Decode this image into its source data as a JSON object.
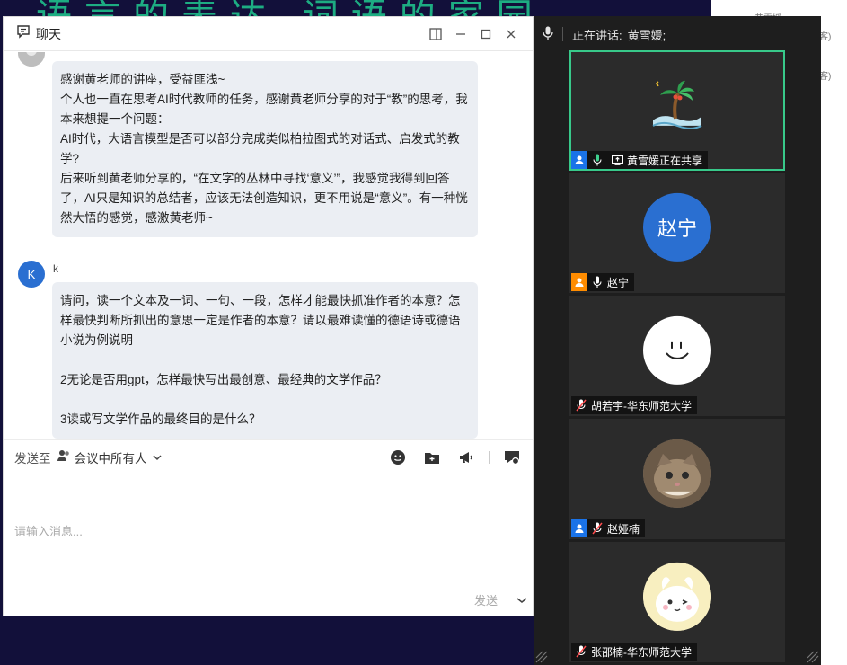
{
  "background": {
    "banner": "语言的表达  词语的家园",
    "right_lines": [
      "黄雪媛",
      "访客)",
      "访客)"
    ]
  },
  "chat": {
    "title": "聊天",
    "messages": [
      {
        "sender": "",
        "avatar_letter": "",
        "lines": [
          "感谢黄老师的讲座，受益匪浅~",
          "个人也一直在思考AI时代教师的任务，感谢黄老师分享的对于“教”的思考，我本来想提一个问题：",
          "AI时代，大语言模型是否可以部分完成类似柏拉图式的对话式、启发式的教学?",
          "后来听到黄老师分享的，“在文字的丛林中寻找‘意义’”，我感觉我得到回答了，AI只是知识的总结者，应该无法创造知识，更不用说是“意义”。有一种恍然大悟的感觉，感激黄老师~"
        ]
      },
      {
        "sender": "k",
        "avatar_letter": "K",
        "lines": [
          "请问，读一个文本及一词、一句、一段，怎样才能最快抓准作者的本意？怎样最快判断所抓出的意思一定是作者的本意？请以最难读懂的德语诗或德语小说为例说明",
          "",
          "2无论是否用gpt，怎样最快写出最创意、最经典的文学作品？",
          "",
          "3读或写文学作品的最终目的是什么？"
        ]
      }
    ],
    "send_to_label": "发送至",
    "recipient": "会议中所有人",
    "input_placeholder": "请输入消息...",
    "send_label": "发送"
  },
  "video": {
    "speaking_label": "正在讲话:",
    "speaking_name": "黄雪媛;",
    "tiles": [
      {
        "name": "黄雪媛正在共享",
        "initials": "",
        "role": "host",
        "mic": "on",
        "sharing": true,
        "active": true
      },
      {
        "name": "赵宁",
        "initials": "赵宁",
        "role": "cohost",
        "mic": "on",
        "sharing": false,
        "active": false
      },
      {
        "name": "胡若宇-华东师范大学",
        "initials": "",
        "role": "",
        "mic": "muted",
        "sharing": false,
        "active": false
      },
      {
        "name": "赵娅楠",
        "initials": "",
        "role": "host",
        "mic": "muted",
        "sharing": false,
        "active": false
      },
      {
        "name": "张邵楠-华东师范大学",
        "initials": "",
        "role": "",
        "mic": "muted",
        "sharing": false,
        "active": false
      }
    ]
  },
  "colors": {
    "accent_green": "#38c98a",
    "avatar_blue": "#2a6fd1",
    "role_blue": "#1a73e8",
    "role_orange": "#ff8c00"
  }
}
